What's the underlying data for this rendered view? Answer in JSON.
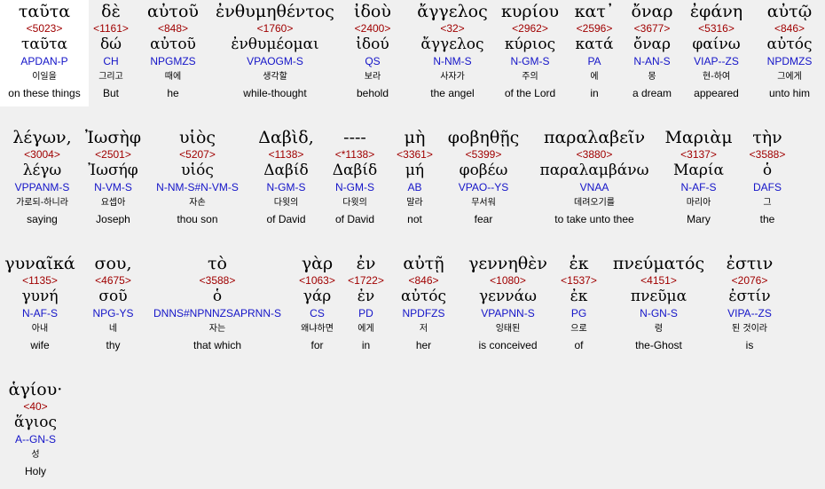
{
  "words": [
    {
      "greek": "ταῦτα",
      "strong": "<5023>",
      "lemma": "ταῦτα",
      "parse": "APDAN-P",
      "korean": "이일을",
      "english": "on these things"
    },
    {
      "greek": "δὲ",
      "strong": "<1161>",
      "lemma": "δώ",
      "parse": "CH",
      "korean": "그리고",
      "english": "But"
    },
    {
      "greek": "αὐτοῦ",
      "strong": "<848>",
      "lemma": "αὐτοῦ",
      "parse": "NPGMZS",
      "korean": "때에",
      "english": "he"
    },
    {
      "greek": "ἐνθυμηθέντος",
      "strong": "<1760>",
      "lemma": "ἐνθυμέομαι",
      "parse": "VPAOGM-S",
      "korean": "생각할",
      "english": "while-thought"
    },
    {
      "greek": "ἰδοὺ",
      "strong": "<2400>",
      "lemma": "ἰδού",
      "parse": "QS",
      "korean": "보라",
      "english": "behold"
    },
    {
      "greek": "ἄγγελος",
      "strong": "<32>",
      "lemma": "ἄγγελος",
      "parse": "N-NM-S",
      "korean": "사자가",
      "english": "the angel"
    },
    {
      "greek": "κυρίου",
      "strong": "<2962>",
      "lemma": "κύριος",
      "parse": "N-GM-S",
      "korean": "주의",
      "english": "of the Lord"
    },
    {
      "greek": "κατ᾽",
      "strong": "<2596>",
      "lemma": "κατά",
      "parse": "PA",
      "korean": "에",
      "english": "in"
    },
    {
      "greek": "ὄναρ",
      "strong": "<3677>",
      "lemma": "ὄναρ",
      "parse": "N-AN-S",
      "korean": "몽",
      "english": "a dream"
    },
    {
      "greek": "ἐφάνη",
      "strong": "<5316>",
      "lemma": "φαίνω",
      "parse": "VIAP--ZS",
      "korean": "현-하여",
      "english": "appeared"
    },
    {
      "greek": "αὐτῷ",
      "strong": "<846>",
      "lemma": "αὐτός",
      "parse": "NPDMZS",
      "korean": "그에게",
      "english": "unto him"
    },
    {
      "greek": "λέγων,",
      "strong": "<3004>",
      "lemma": "λέγω",
      "parse": "VPPANM-S",
      "korean": "가로되-하니라",
      "english": "saying"
    },
    {
      "greek": "Ἰωσὴφ",
      "strong": "<2501>",
      "lemma": "Ἰωσήφ",
      "parse": "N-VM-S",
      "korean": "요셉아",
      "english": "Joseph"
    },
    {
      "greek": "υἱὸς",
      "strong": "<5207>",
      "lemma": "υἱός",
      "parse": "N-NM-S#N-VM-S",
      "korean": "자손",
      "english": "thou son"
    },
    {
      "greek": "Δαβὶδ,",
      "strong": "<1138>",
      "lemma": "Δαβίδ",
      "parse": "N-GM-S",
      "korean": "다윗의",
      "english": "of David"
    },
    {
      "greek": "----",
      "strong": "<*1138>",
      "lemma": "Δαβίδ",
      "parse": "N-GM-S",
      "korean": "다윗의",
      "english": "of David"
    },
    {
      "greek": "μὴ",
      "strong": "<3361>",
      "lemma": "μή",
      "parse": "AB",
      "korean": "말라",
      "english": "not"
    },
    {
      "greek": "φοβηθῇς",
      "strong": "<5399>",
      "lemma": "φοβέω",
      "parse": "VPAO--YS",
      "korean": "무서워",
      "english": "fear"
    },
    {
      "greek": "παραλαβεῖν",
      "strong": "<3880>",
      "lemma": "παραλαμβάνω",
      "parse": "VNAA",
      "korean": "데려오기를",
      "english": "to take unto thee"
    },
    {
      "greek": "Μαριὰμ",
      "strong": "<3137>",
      "lemma": "Μαρία",
      "parse": "N-AF-S",
      "korean": "마리아",
      "english": "Mary"
    },
    {
      "greek": "τὴν",
      "strong": "<3588>",
      "lemma": "ὁ",
      "parse": "DAFS",
      "korean": "그",
      "english": "the"
    },
    {
      "greek": "γυναῖκά",
      "strong": "<1135>",
      "lemma": "γυνή",
      "parse": "N-AF-S",
      "korean": "아내",
      "english": "wife"
    },
    {
      "greek": "σου,",
      "strong": "<4675>",
      "lemma": "σοῦ",
      "parse": "NPG-YS",
      "korean": "네",
      "english": "thy"
    },
    {
      "greek": "τὸ",
      "strong": "<3588>",
      "lemma": "ὁ",
      "parse": "DNNS#NPNNZSAPRNN-S",
      "korean": "자는",
      "english": "that which"
    },
    {
      "greek": "γὰρ",
      "strong": "<1063>",
      "lemma": "γάρ",
      "parse": "CS",
      "korean": "왜냐하면",
      "english": "for"
    },
    {
      "greek": "ἐν",
      "strong": "<1722>",
      "lemma": "ἐν",
      "parse": "PD",
      "korean": "에게",
      "english": "in"
    },
    {
      "greek": "αὐτῇ",
      "strong": "<846>",
      "lemma": "αὐτός",
      "parse": "NPDFZS",
      "korean": "저",
      "english": "her"
    },
    {
      "greek": "γεννηθὲν",
      "strong": "<1080>",
      "lemma": "γεννάω",
      "parse": "VPAPNN-S",
      "korean": "잉태된",
      "english": "is conceived"
    },
    {
      "greek": "ἐκ",
      "strong": "<1537>",
      "lemma": "ἐκ",
      "parse": "PG",
      "korean": "으로",
      "english": "of"
    },
    {
      "greek": "πνεύματός",
      "strong": "<4151>",
      "lemma": "πνεῦμα",
      "parse": "N-GN-S",
      "korean": "령",
      "english": "the-Ghost"
    },
    {
      "greek": "ἐστιν",
      "strong": "<2076>",
      "lemma": "ἐστίν",
      "parse": "VIPA--ZS",
      "korean": "된 것이라",
      "english": "is"
    },
    {
      "greek": "ἁγίου·",
      "strong": "<40>",
      "lemma": "ἅγιος",
      "parse": "A--GN-S",
      "korean": "성",
      "english": "Holy"
    }
  ]
}
